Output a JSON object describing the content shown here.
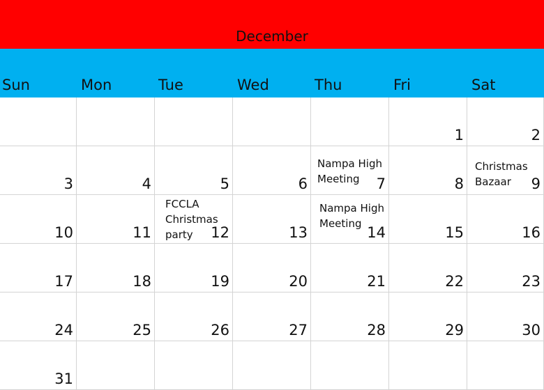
{
  "calendar": {
    "month": "December",
    "colors": {
      "title_band": "#ff0000",
      "days_band": "#00b0f0"
    },
    "weekdays": [
      "Sun",
      "Mon",
      "Tue",
      "Wed",
      "Thu",
      "Fri",
      "Sat"
    ],
    "weeks": [
      [
        "",
        "",
        "",
        "",
        "",
        "1",
        "2"
      ],
      [
        "3",
        "4",
        "5",
        "6",
        "7",
        "8",
        "9"
      ],
      [
        "10",
        "11",
        "12",
        "13",
        "14",
        "15",
        "16"
      ],
      [
        "17",
        "18",
        "19",
        "20",
        "21",
        "22",
        "23"
      ],
      [
        "24",
        "25",
        "26",
        "27",
        "28",
        "29",
        "30"
      ],
      [
        "31",
        "",
        "",
        "",
        "",
        "",
        ""
      ]
    ],
    "events": [
      {
        "date": "7",
        "text": "Nampa High Meeting"
      },
      {
        "date": "9",
        "text": "Christmas Bazaar"
      },
      {
        "date": "12",
        "text": "FCCLA Christmas party"
      },
      {
        "date": "14",
        "text": "Nampa High Meeting"
      }
    ]
  }
}
